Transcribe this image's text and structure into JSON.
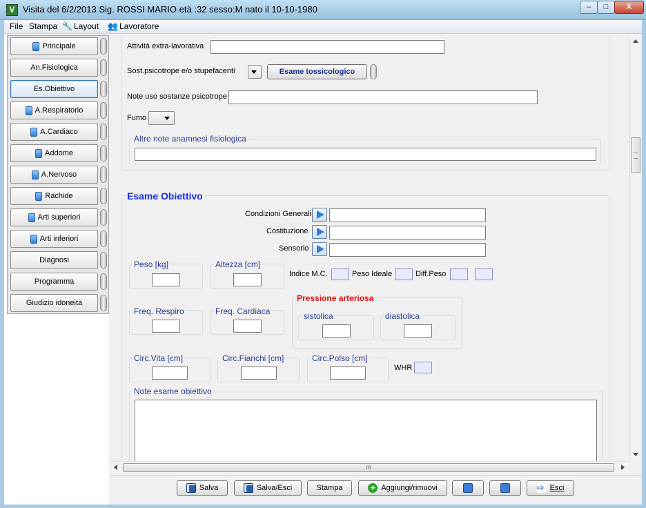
{
  "window": {
    "app_icon": "V",
    "title": "Visita del 6/2/2013 Sig. ROSSI MARIO età :32 sesso:M nato il 10-10-1980",
    "min": "–",
    "max": "□",
    "close": "X"
  },
  "menu": {
    "file": "File",
    "stampa": "Stampa",
    "layout": "Layout",
    "lavoratore": "Lavoratore"
  },
  "sidebar": {
    "items": [
      {
        "label": "Principale"
      },
      {
        "label": "An.Fisiologica"
      },
      {
        "label": "Es.Obiettivo"
      },
      {
        "label": "A.Respiratorio"
      },
      {
        "label": "A.Cardiaco"
      },
      {
        "label": "Addome"
      },
      {
        "label": "A.Nervoso"
      },
      {
        "label": "Rachide"
      },
      {
        "label": "Arti superiori"
      },
      {
        "label": "Arti inferiori"
      },
      {
        "label": "Diagnosi"
      },
      {
        "label": "Programma"
      },
      {
        "label": "Giudizio idoneità"
      }
    ]
  },
  "anamnesi": {
    "attivita_label": "Attività extra-lavorativa",
    "attivita_value": "",
    "sost_label": "Sost.psicotrope e/o stupefacenti",
    "sost_value": "",
    "esame_tox_button": "Esame tossicologico",
    "note_uso_label": "Note uso sostanze psicotrope",
    "note_uso_value": "",
    "fumo_label": "Fumo",
    "fumo_value": "",
    "altre_note_legend": "Altre note anamnesi fisiologica",
    "altre_note_value": ""
  },
  "esame": {
    "title": "Esame Obiettivo",
    "condizioni_label": "Condizioni Generali",
    "condizioni_value": "",
    "costituzione_label": "Costituzione",
    "costituzione_value": "",
    "sensorio_label": "Sensorio",
    "sensorio_value": "",
    "peso_legend": "Peso [kg]",
    "peso_value": "",
    "altezza_legend": "Altezza [cm]",
    "altezza_value": "",
    "imc_label": "Indice M.C.",
    "peso_ideale_label": "Peso Ideale",
    "diff_peso_label": "Diff.Peso",
    "freq_respiro_legend": "Freq. Respiro",
    "freq_cardiaca_legend": "Freq. Cardiaca",
    "pressione_title": "Pressione arteriosa",
    "sistolica_legend": "sistolica",
    "diastolica_legend": "diastolica",
    "circ_vita_legend": "Circ.Vita [cm]",
    "circ_fianchi_legend": "Circ.Fianchi [cm]",
    "circ_polso_legend": "Circ.Polso [cm]",
    "whr_label": "WHR",
    "note_legend": "Note esame obiettivo",
    "note_value": ""
  },
  "scroll": {
    "hthumb_grip": "III"
  },
  "toolbar": {
    "salva": "Salva",
    "salva_esci": "Salva/Esci",
    "stampa": "Stampa",
    "aggiungi": "Aggiungi/rimuovi",
    "esci": "Esci"
  }
}
